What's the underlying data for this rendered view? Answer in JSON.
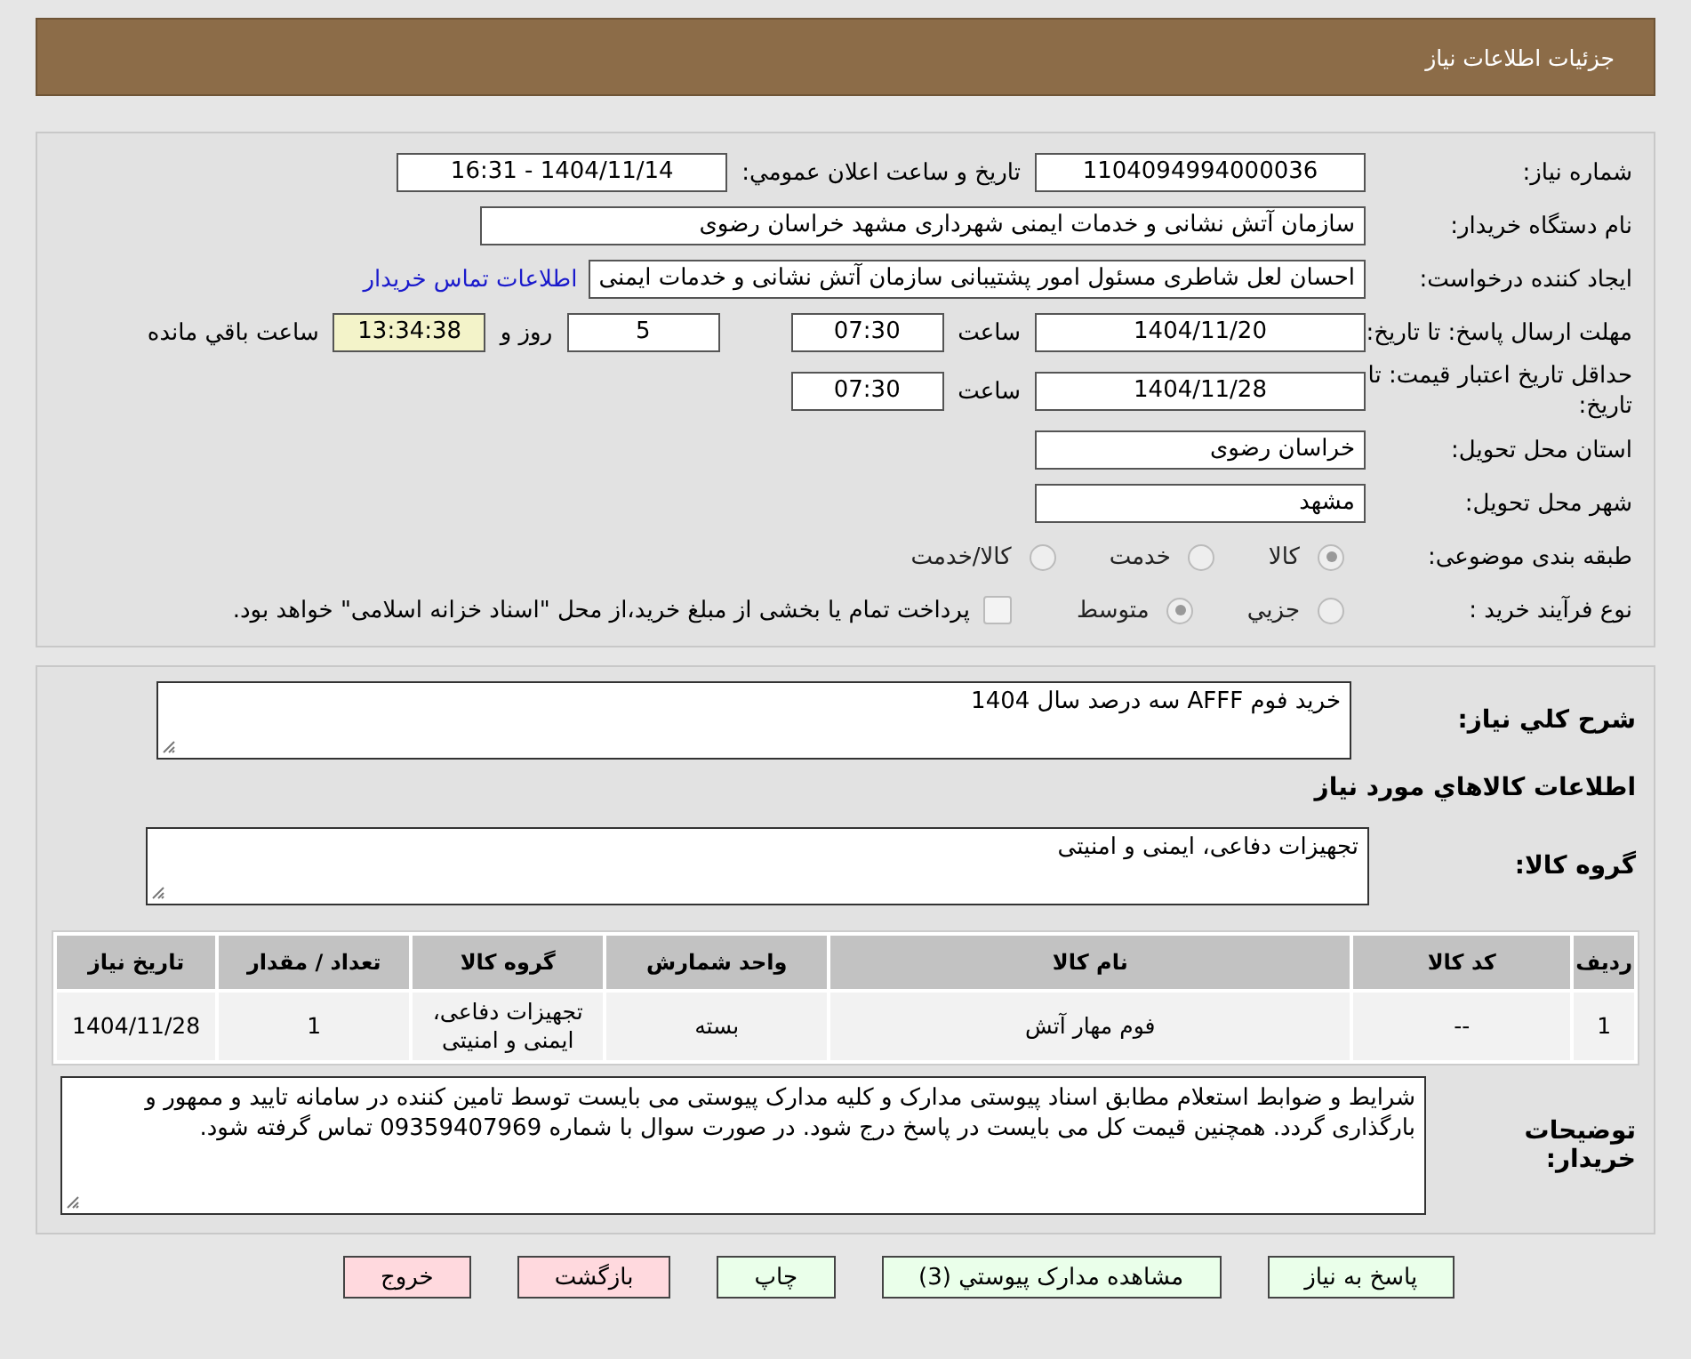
{
  "header": {
    "title": "جزئیات اطلاعات نیاز"
  },
  "need_number": {
    "label": "شماره نیاز:",
    "value": "1104094994000036"
  },
  "announce": {
    "label": "تاریخ و ساعت اعلان عمومي:",
    "value": "1404/11/14 - 16:31"
  },
  "buyer_org": {
    "label": "نام دستگاه خریدار:",
    "value": "سازمان آتش نشانی و خدمات ایمنی شهرداری مشهد خراسان رضوی"
  },
  "requester": {
    "label": "ایجاد کننده درخواست:",
    "value": "احسان لعل شاطری مسئول امور پشتیبانی سازمان آتش نشانی و خدمات ایمنی",
    "link": "اطلاعات تماس خریدار"
  },
  "response_deadline": {
    "label": "مهلت ارسال پاسخ: تا تاریخ:",
    "date": "1404/11/20",
    "time_label": "ساعت",
    "time": "07:30",
    "days": "5",
    "days_label": "روز و",
    "remaining": "13:34:38",
    "remaining_label": "ساعت باقي مانده"
  },
  "price_validity": {
    "label": "حداقل تاریخ اعتبار قیمت: تا تاریخ:",
    "date": "1404/11/28",
    "time_label": "ساعت",
    "time": "07:30"
  },
  "province": {
    "label": "استان محل تحویل:",
    "value": "خراسان رضوی"
  },
  "city": {
    "label": "شهر محل تحویل:",
    "value": "مشهد"
  },
  "category": {
    "label": "طبقه بندی موضوعی:",
    "options": [
      {
        "label": "کالا",
        "selected": true
      },
      {
        "label": "خدمت",
        "selected": false
      },
      {
        "label": "کالا/خدمت",
        "selected": false
      }
    ]
  },
  "process": {
    "label": "نوع فرآیند خرید :",
    "options": [
      {
        "label": "جزیي",
        "selected": false
      },
      {
        "label": "متوسط",
        "selected": true
      }
    ],
    "payment": {
      "checked": false,
      "text": "پرداخت تمام یا بخشی از مبلغ خرید،از محل \"اسناد خزانه اسلامی\" خواهد بود."
    }
  },
  "description": {
    "label": "شرح کلي نياز:",
    "value": "خرید فوم AFFF سه درصد سال 1404"
  },
  "goods_title": "اطلاعات کالاهاي مورد نياز",
  "goods_group": {
    "label": "گروه کالا:",
    "value": "تجهیزات دفاعی، ایمنی و امنیتی"
  },
  "table": {
    "columns": [
      "ردیف",
      "کد کالا",
      "نام کالا",
      "واحد شمارش",
      "گروه کالا",
      "تعداد / مقدار",
      "تاریخ نیاز"
    ],
    "rows": [
      [
        "1",
        "--",
        "فوم مهار آتش",
        "بسته",
        "تجهیزات دفاعی، ایمنی و امنیتی",
        "1",
        "1404/11/28"
      ]
    ]
  },
  "buyer_notes": {
    "label": "توضیحات خریدار:",
    "value": "شرایط و ضوابط استعلام مطابق اسناد پیوستی مدارک و کلیه مدارک پیوستی می بایست توسط تامین کننده در سامانه تایید و ممهور و بارگذاری گردد. همچنین قیمت کل می بایست در پاسخ درج شود. در صورت سوال با شماره 09359407969 تماس گرفته شود."
  },
  "buttons": [
    {
      "label": "پاسخ به نياز",
      "kind": "action"
    },
    {
      "label": "مشاهده مدارک پیوستي (3)",
      "kind": "action"
    },
    {
      "label": "چاپ",
      "kind": "action"
    },
    {
      "label": "بازگشت",
      "kind": "exit"
    },
    {
      "label": "خروج",
      "kind": "exit"
    }
  ]
}
